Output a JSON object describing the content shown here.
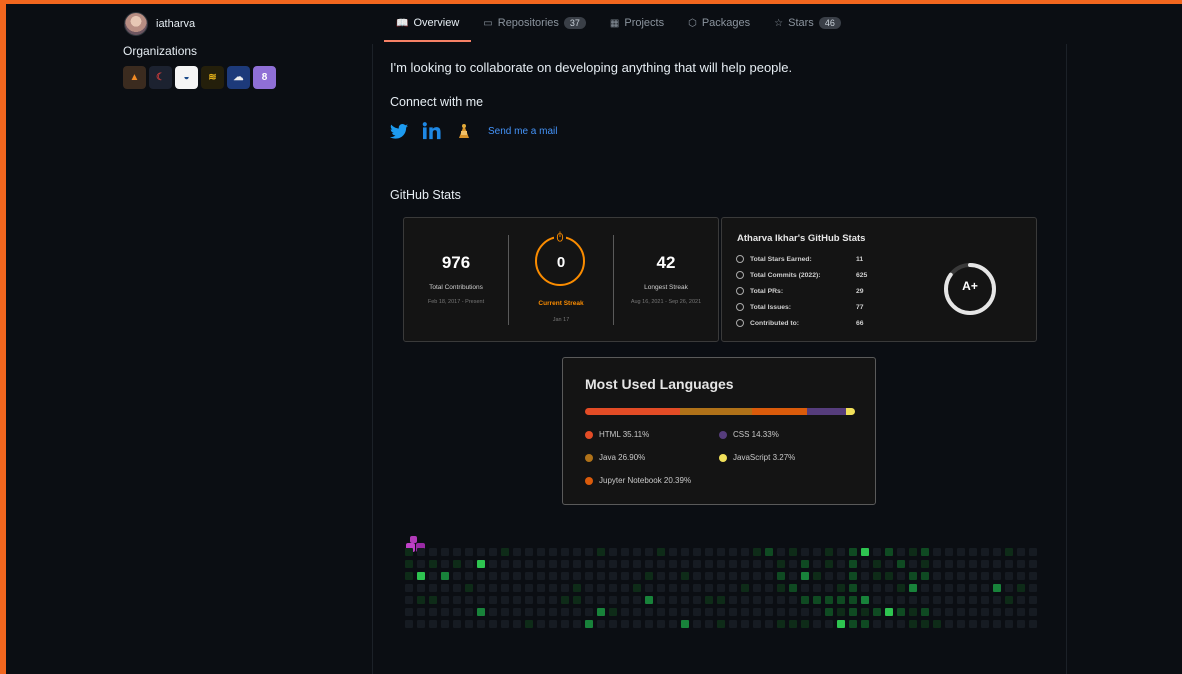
{
  "user": {
    "name": "iatharva"
  },
  "orgs_title": "Organizations",
  "orgs": [
    {
      "name": "org-fox-icon",
      "bg": "#3b2b1f",
      "fg": "#f08a24",
      "glyph": "▲"
    },
    {
      "name": "org-moon-icon",
      "bg": "#1c2230",
      "fg": "#c23b3b",
      "glyph": "☾"
    },
    {
      "name": "org-wave-icon",
      "bg": "#f5f5f5",
      "fg": "#1b4a8a",
      "glyph": "◒"
    },
    {
      "name": "org-dsc-icon",
      "bg": "#241f0b",
      "fg": "#e5b21a",
      "glyph": "≋"
    },
    {
      "name": "org-cloud-icon",
      "bg": "#1d3a7a",
      "fg": "#eeeeee",
      "glyph": "☁"
    },
    {
      "name": "org-block-icon",
      "bg": "#8f6fd6",
      "fg": "#ffffff",
      "glyph": "8"
    }
  ],
  "tabs": [
    {
      "label": "Overview",
      "icon": "book-icon",
      "glyph": "📖",
      "count": null
    },
    {
      "label": "Repositories",
      "icon": "repo-icon",
      "glyph": "▭",
      "count": "37"
    },
    {
      "label": "Projects",
      "icon": "project-icon",
      "glyph": "▦",
      "count": null
    },
    {
      "label": "Packages",
      "icon": "package-icon",
      "glyph": "⬡",
      "count": null
    },
    {
      "label": "Stars",
      "icon": "star-icon",
      "glyph": "☆",
      "count": "46"
    }
  ],
  "readme": {
    "intro": "I'm looking to collaborate on developing anything that will help people.",
    "connect": "Connect with me",
    "mail_link": "Send me a mail",
    "stats_title": "GitHub Stats"
  },
  "streak": {
    "total": "976",
    "total_label": "Total Contributions",
    "total_dates": "Feb 18, 2017 - Present",
    "current": "0",
    "current_label": "Current Streak",
    "current_date": "Jan 17",
    "longest": "42",
    "longest_label": "Longest Streak",
    "longest_dates": "Aug 16, 2021 - Sep 26, 2021",
    "accent": "#fb8c00"
  },
  "gh_stats": {
    "title": "Atharva Ikhar's GitHub Stats",
    "rows": [
      {
        "label": "Total Stars Earned:",
        "value": "11"
      },
      {
        "label": "Total Commits (2022):",
        "value": "625"
      },
      {
        "label": "Total PRs:",
        "value": "29"
      },
      {
        "label": "Total Issues:",
        "value": "77"
      },
      {
        "label": "Contributed to:",
        "value": "66"
      }
    ],
    "grade": "A+",
    "grade_fraction": 0.85
  },
  "languages": {
    "title": "Most Used Languages",
    "items": [
      {
        "name": "HTML",
        "percent": "35.11%",
        "share": 35.11,
        "color": "#e34c26"
      },
      {
        "name": "Java",
        "percent": "26.90%",
        "share": 26.9,
        "color": "#b07219"
      },
      {
        "name": "Jupyter Notebook",
        "percent": "20.39%",
        "share": 20.39,
        "color": "#da5b0b"
      },
      {
        "name": "CSS",
        "percent": "14.33%",
        "share": 14.33,
        "color": "#563d7c"
      },
      {
        "name": "JavaScript",
        "percent": "3.27%",
        "share": 3.27,
        "color": "#f1e05a"
      }
    ]
  },
  "contributions": {
    "empty_color": "#161b22",
    "levels": [
      "#0e2b18",
      "#0f4a22",
      "#18823a",
      "#2ec450"
    ]
  }
}
